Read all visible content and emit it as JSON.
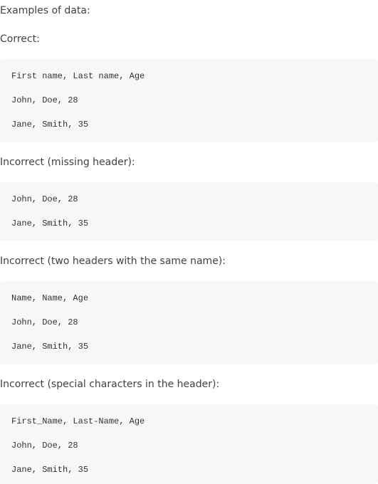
{
  "intro": "Examples of data:",
  "sections": [
    {
      "label": "Correct:",
      "lines": [
        "First name, Last name, Age",
        "John, Doe, 28",
        "Jane, Smith, 35"
      ]
    },
    {
      "label": "Incorrect (missing header):",
      "lines": [
        "John, Doe, 28",
        "Jane, Smith, 35"
      ]
    },
    {
      "label": "Incorrect (two headers with the same name):",
      "lines": [
        "Name, Name, Age",
        "John, Doe, 28",
        "Jane, Smith, 35"
      ]
    },
    {
      "label": "Incorrect (special characters in the header):",
      "lines": [
        "First_Name, Last-Name, Age",
        "John, Doe, 28",
        "Jane, Smith, 35"
      ]
    }
  ]
}
